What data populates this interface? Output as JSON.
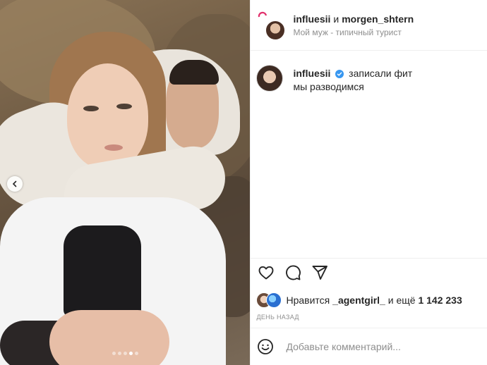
{
  "header": {
    "user1": "influesii",
    "separator": "и",
    "user2": "morgen_shtern",
    "subtitle": "Мой муж - типичный турист"
  },
  "caption": {
    "username": "influesii",
    "line1": "записали фит",
    "line2": "мы разводимся"
  },
  "likes": {
    "prefix": "Нравится",
    "liker": "_agentgirl_",
    "middle": "и ещё",
    "count": "1 142 233"
  },
  "timestamp": "ДЕНЬ НАЗАД",
  "comment": {
    "placeholder": "Добавьте комментарий..."
  },
  "carousel": {
    "dot_count": 5,
    "active_index": 3
  },
  "colors": {
    "verified": "#3897f0",
    "text": "#262626",
    "muted": "#8e8e8e",
    "story_ring": "#e1306c"
  },
  "icons": {
    "like": "heart-icon",
    "comment": "comment-icon",
    "share": "paper-plane-icon",
    "emoji": "smiley-icon",
    "verified": "verified-badge-icon",
    "prev": "chevron-left-icon"
  }
}
